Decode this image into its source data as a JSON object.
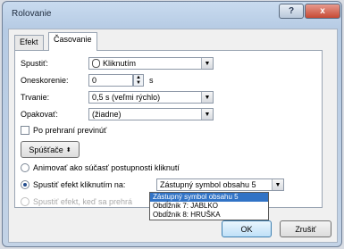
{
  "dialog": {
    "title": "Rolovanie",
    "help_icon": "?",
    "close_icon": "x"
  },
  "tabs": [
    {
      "label": "Efekt"
    },
    {
      "label": "Časovanie"
    }
  ],
  "form": {
    "start": {
      "label": "Spustiť:",
      "value": "Kliknutím",
      "icon": "mouse-click-icon"
    },
    "delay": {
      "label": "Oneskorenie:",
      "value": "0",
      "unit": "s"
    },
    "duration": {
      "label": "Trvanie:",
      "value": "0,5 s (veľmi rýchlo)"
    },
    "repeat": {
      "label": "Opakovať:",
      "value": "(žiadne)"
    },
    "rewind": {
      "label": "Po prehraní previnúť",
      "checked": false
    }
  },
  "triggers": {
    "button_label": "Spúšťače",
    "option1": "Animovať ako súčasť postupnosti kliknutí",
    "option2_label": "Spustiť efekt kliknutím na:",
    "option2_value": "Zástupný symbol obsahu 5",
    "option3_label": "Spustiť efekt, keď sa prehrá",
    "selected": 2
  },
  "dropdown_items": [
    "Zástupný symbol obsahu 5",
    "Obdĺžnik 7: JABLKO",
    "Obdĺžnik 8: HRUŠKA"
  ],
  "buttons": {
    "ok": "OK",
    "cancel": "Zrušiť"
  },
  "colors": {
    "accent": "#3173c6",
    "close": "#c64a34"
  }
}
